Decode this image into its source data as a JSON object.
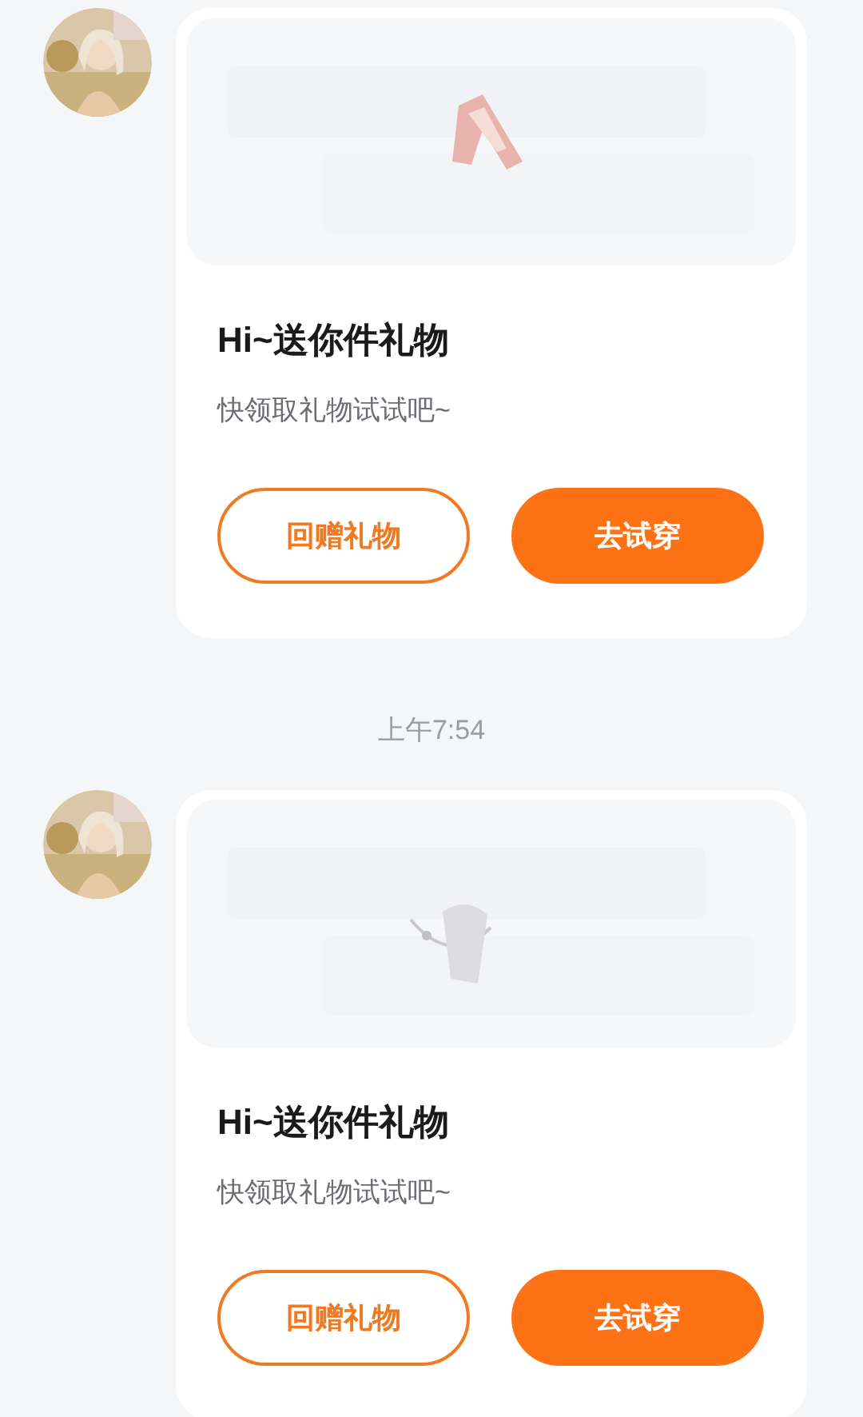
{
  "messages": [
    {
      "kind": "gift",
      "title": "Hi~送你件礼物",
      "subtitle": "快领取礼物试试吧~",
      "buttons": [
        {
          "label": "回赠礼物",
          "kind": "outline"
        },
        {
          "label": "去试穿",
          "kind": "filled"
        }
      ]
    },
    {
      "kind": "time",
      "text": "上午7:54"
    },
    {
      "kind": "gift",
      "title": "Hi~送你件礼物",
      "subtitle": "快领取礼物试试吧~",
      "buttons": [
        {
          "label": "回赠礼物",
          "kind": "outline"
        },
        {
          "label": "去试穿",
          "kind": "filled"
        }
      ]
    }
  ]
}
